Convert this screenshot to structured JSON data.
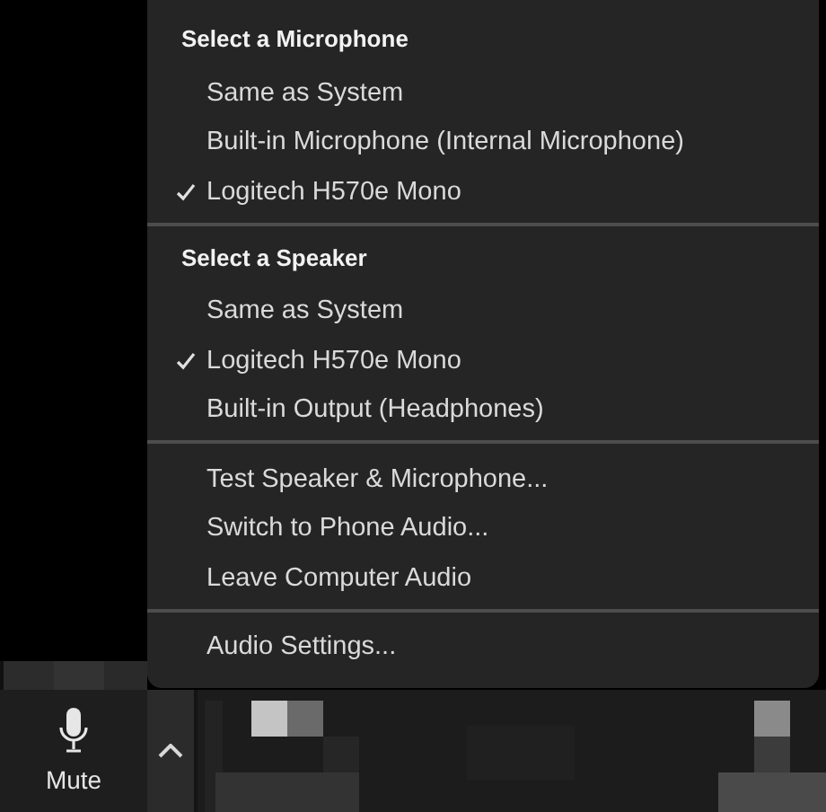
{
  "audio_menu": {
    "sections": [
      {
        "header": "Select a Microphone",
        "items": [
          {
            "label": "Same as System",
            "checked": false
          },
          {
            "label": "Built-in Microphone (Internal Microphone)",
            "checked": false
          },
          {
            "label": "Logitech H570e Mono",
            "checked": true
          }
        ]
      },
      {
        "header": "Select a Speaker",
        "items": [
          {
            "label": "Same as System",
            "checked": false
          },
          {
            "label": "Logitech H570e Mono",
            "checked": true
          },
          {
            "label": "Built-in Output (Headphones)",
            "checked": false
          }
        ]
      },
      {
        "items": [
          {
            "label": "Test Speaker & Microphone...",
            "checked": false
          },
          {
            "label": "Switch to Phone Audio...",
            "checked": false
          },
          {
            "label": "Leave Computer Audio",
            "checked": false
          }
        ]
      },
      {
        "items": [
          {
            "label": "Audio Settings...",
            "checked": false
          }
        ]
      }
    ]
  },
  "toolbar": {
    "mute_button": {
      "label": "Mute"
    }
  }
}
